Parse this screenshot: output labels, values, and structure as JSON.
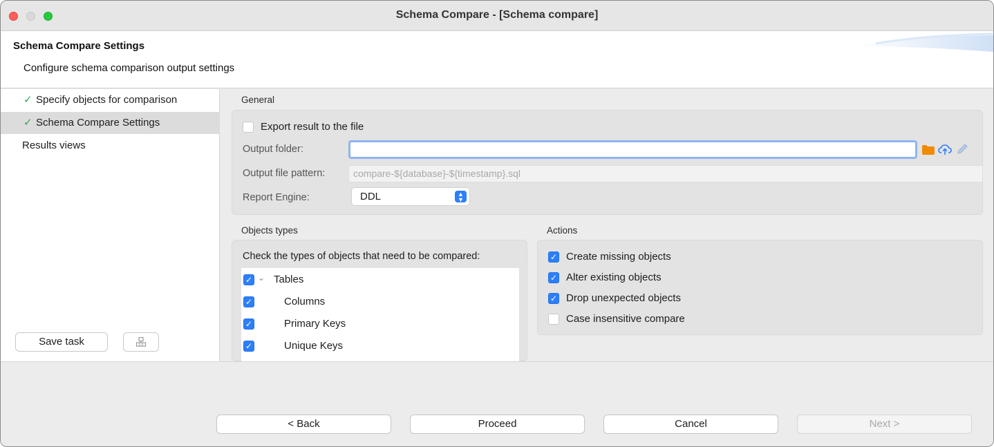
{
  "window": {
    "title": "Schema Compare - [Schema compare]"
  },
  "header": {
    "title": "Schema Compare Settings",
    "subtitle": "Configure schema comparison output settings"
  },
  "nav": {
    "items": [
      {
        "label": "Specify objects for comparison",
        "checked": true,
        "selected": false
      },
      {
        "label": "Schema Compare Settings",
        "checked": true,
        "selected": true
      },
      {
        "label": "Results views",
        "checked": false,
        "selected": false
      }
    ],
    "save_task_label": "Save task",
    "save_icon": "layout-icon"
  },
  "general": {
    "label": "General",
    "export_label": "Export result to the file",
    "export_checked": false,
    "output_folder_label": "Output folder:",
    "output_folder_value": "",
    "output_pattern_label": "Output file pattern:",
    "output_pattern_value": "compare-${database}-${timestamp}.sql",
    "report_engine_label": "Report Engine:",
    "report_engine_value": "DDL"
  },
  "object_types": {
    "label": "Objects types",
    "instruction": "Check the types of objects that need to be compared:",
    "items": [
      {
        "label": "Tables",
        "checked": true,
        "expandable": true,
        "indent": 0
      },
      {
        "label": "Columns",
        "checked": true,
        "expandable": false,
        "indent": 1
      },
      {
        "label": "Primary Keys",
        "checked": true,
        "expandable": false,
        "indent": 1
      },
      {
        "label": "Unique Keys",
        "checked": true,
        "expandable": false,
        "indent": 1
      }
    ]
  },
  "actions": {
    "label": "Actions",
    "items": [
      {
        "label": "Create missing objects",
        "checked": true
      },
      {
        "label": "Alter existing objects",
        "checked": true
      },
      {
        "label": "Drop unexpected objects",
        "checked": true
      },
      {
        "label": "Case insensitive compare",
        "checked": false
      }
    ]
  },
  "footer": {
    "back": "< Back",
    "proceed": "Proceed",
    "cancel": "Cancel",
    "next": "Next >"
  },
  "colors": {
    "accent": "#2d7ff9",
    "check_green": "#2fa84f",
    "folder_orange": "#f08a00"
  }
}
